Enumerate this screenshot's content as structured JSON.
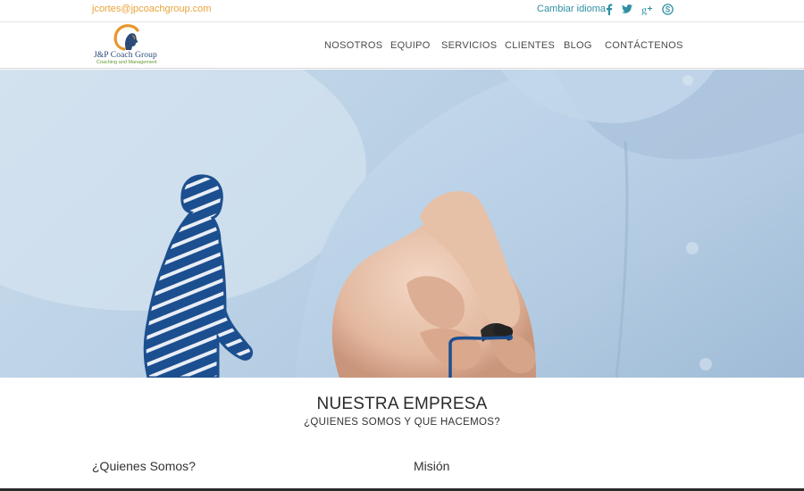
{
  "topbar": {
    "email": "jcortes@jpcoachgroup.com",
    "change_language": "Cambiar idioma",
    "social_icons": [
      "facebook-icon",
      "twitter-icon",
      "google-plus-icon",
      "skype-icon"
    ]
  },
  "logo": {
    "name": "J&P Coach Group",
    "tagline": "Coaching and Management"
  },
  "nav": {
    "items": [
      "NOSOTROS",
      "EQUIPO",
      "SERVICIOS",
      "CLIENTES",
      "BLOG",
      "CONTÁCTENOS"
    ]
  },
  "content": {
    "title": "NUESTRA EMPRESA",
    "subtitle": "¿QUIENES SOMOS Y QUE HACEMOS?",
    "col_left_title": "¿Quienes Somos?",
    "col_right_title": "Misión"
  },
  "colors": {
    "email": "#e8a33c",
    "link": "#2f8fa3",
    "nav_text": "#4a4a4a",
    "figure_blue": "#1c4f8f"
  }
}
